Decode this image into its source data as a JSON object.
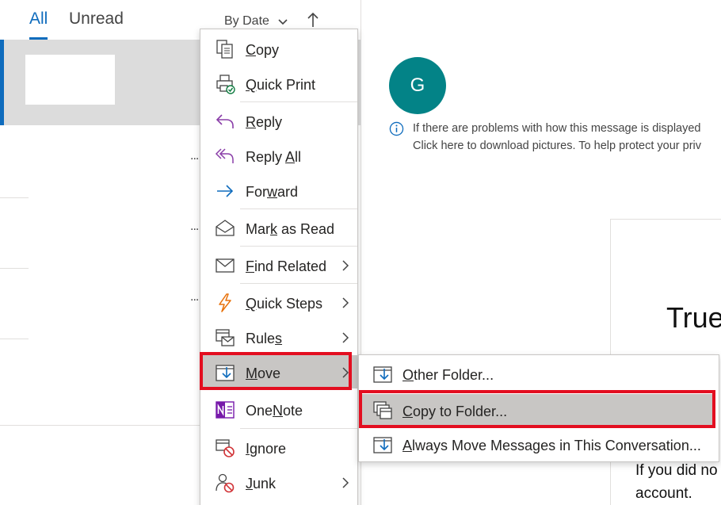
{
  "list": {
    "tabs": {
      "all": "All",
      "unread": "Unread"
    },
    "sort_label": "By Date",
    "row_dots": "..."
  },
  "reading": {
    "avatar_initial": "G",
    "info_line1": "If there are problems with how this message is displayed",
    "info_line2": "Click here to download pictures. To help protect your priv",
    "card_title": "True",
    "card_text1": "If you did no",
    "card_text2": "account."
  },
  "context_menu": {
    "items": [
      {
        "pre": "",
        "key": "C",
        "post": "opy",
        "icon": "copy-icon"
      },
      {
        "pre": "",
        "key": "Q",
        "post": "uick Print",
        "icon": "quick-print-icon"
      },
      {
        "pre": "",
        "key": "R",
        "post": "eply",
        "icon": "reply-icon"
      },
      {
        "pre": "Reply ",
        "key": "A",
        "post": "ll",
        "icon": "reply-all-icon"
      },
      {
        "pre": "For",
        "key": "w",
        "post": "ard",
        "icon": "forward-icon"
      },
      {
        "pre": "Mar",
        "key": "k",
        "post": " as Read",
        "icon": "envelope-open-icon"
      },
      {
        "pre": "",
        "key": "F",
        "post": "ind Related",
        "icon": "envelope-icon",
        "submenu": true
      },
      {
        "pre": "",
        "key": "Q",
        "post": "uick Steps",
        "icon": "lightning-icon",
        "submenu": true
      },
      {
        "pre": "Rule",
        "key": "s",
        "post": "",
        "icon": "rules-icon",
        "submenu": true
      },
      {
        "pre": "",
        "key": "M",
        "post": "ove",
        "icon": "move-icon",
        "submenu": true,
        "highlighted": true
      },
      {
        "pre": "One",
        "key": "N",
        "post": "ote",
        "icon": "onenote-icon"
      },
      {
        "pre": "",
        "key": "I",
        "post": "gnore",
        "icon": "ignore-icon"
      },
      {
        "pre": "",
        "key": "J",
        "post": "unk",
        "icon": "junk-icon",
        "submenu": true
      }
    ]
  },
  "move_submenu": {
    "items": [
      {
        "pre": "",
        "key": "O",
        "post": "ther Folder...",
        "icon": "other-folder-icon"
      },
      {
        "pre": "",
        "key": "C",
        "post": "opy to Folder...",
        "icon": "copy-to-folder-icon",
        "highlighted": true
      },
      {
        "pre": "",
        "key": "A",
        "post": "lways Move Messages in This Conversation...",
        "icon": "always-move-icon"
      }
    ]
  },
  "colors": {
    "accent": "#0f6cbd",
    "avatar": "#038387",
    "highlight_box": "#e30e20",
    "hover": "#c8c6c4"
  }
}
